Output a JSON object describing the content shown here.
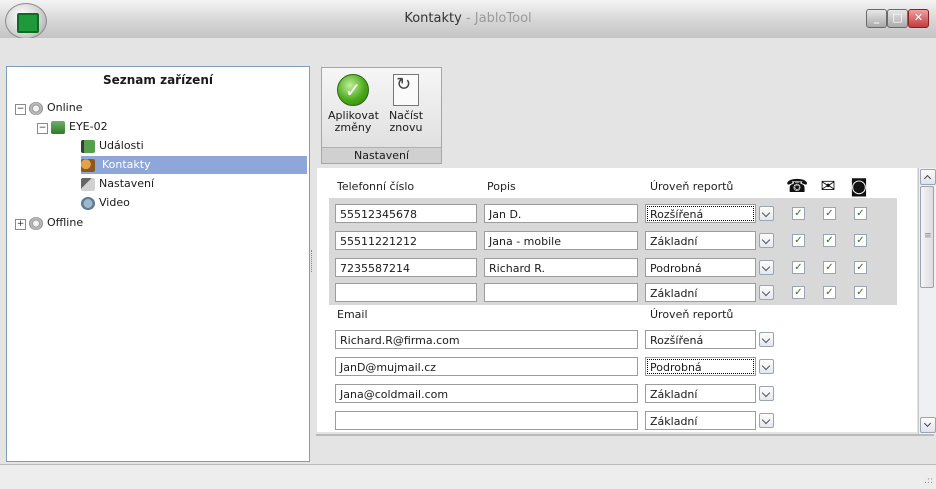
{
  "window": {
    "title_main": "Kontakty",
    "title_sep": " - ",
    "title_app": "JabloTool",
    "btn_min": "_",
    "btn_max": "□",
    "btn_close": "✕"
  },
  "tree": {
    "header": "Seznam zařízení",
    "items": [
      {
        "label": "Online",
        "expander": "−"
      },
      {
        "label": "EYE-02",
        "expander": "−"
      },
      {
        "label": "Události"
      },
      {
        "label": "Kontakty"
      },
      {
        "label": "Nastavení"
      },
      {
        "label": "Video"
      },
      {
        "label": "Offline",
        "expander": "+"
      }
    ]
  },
  "ribbon": {
    "apply_line1": "Aplikovat",
    "apply_line2": "změny",
    "reload_line1": "Načíst",
    "reload_line2": "znovu",
    "group": "Nastavení",
    "apply_icon": "check-icon",
    "reload_icon": "reload-icon"
  },
  "phones": {
    "headers": {
      "phone": "Telefonní číslo",
      "desc": "Popis",
      "level": "Úroveň reportů"
    },
    "icons": [
      "phone-icon",
      "envelope-icon",
      "camera-icon"
    ],
    "rows": [
      {
        "phone": "55512345678",
        "desc": "Jan D.",
        "level": "Rozšířená",
        "flags": [
          true,
          true,
          true
        ]
      },
      {
        "phone": "55511221212",
        "desc": "Jana - mobile",
        "level": "Základní",
        "flags": [
          true,
          true,
          true
        ]
      },
      {
        "phone": "7235587214",
        "desc": "Richard R.",
        "level": "Podrobná",
        "flags": [
          true,
          true,
          true
        ]
      },
      {
        "phone": "",
        "desc": "",
        "level": "Základní",
        "flags": [
          true,
          true,
          true
        ]
      }
    ]
  },
  "emails": {
    "headers": {
      "email": "Email",
      "level": "Úroveň reportů"
    },
    "rows": [
      {
        "email": "Richard.R@firma.com",
        "level": "Rozšířená"
      },
      {
        "email": "JanD@mujmail.cz",
        "level": "Podrobná"
      },
      {
        "email": "Jana@coldmail.com",
        "level": "Základní"
      },
      {
        "email": "",
        "level": "Základní"
      }
    ]
  },
  "status": {
    "grip": ".::"
  }
}
